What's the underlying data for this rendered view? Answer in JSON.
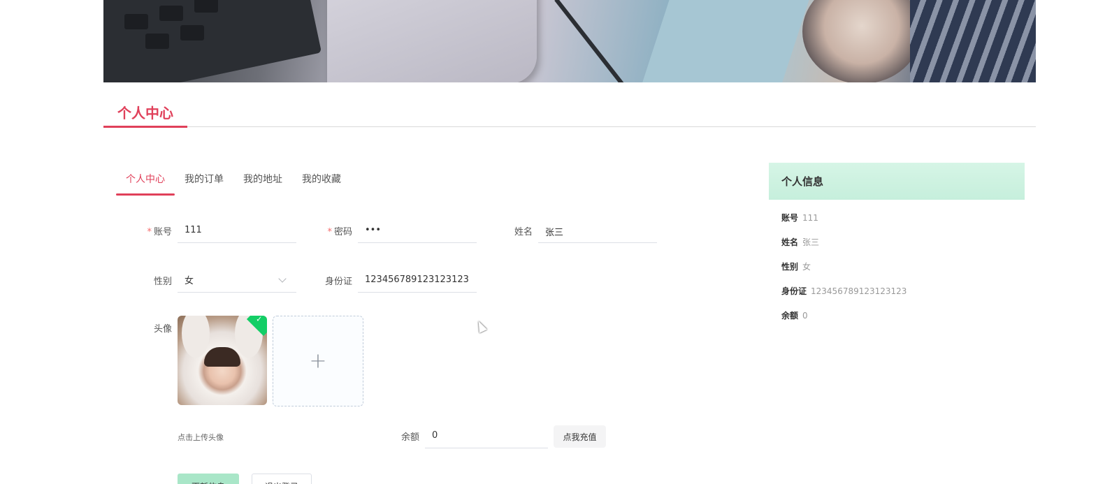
{
  "section": {
    "title": "个人中心"
  },
  "tabs": [
    {
      "label": "个人中心",
      "active": true
    },
    {
      "label": "我的订单",
      "active": false
    },
    {
      "label": "我的地址",
      "active": false
    },
    {
      "label": "我的收藏",
      "active": false
    }
  ],
  "form": {
    "account": {
      "label": "账号",
      "value": "111",
      "required": "*"
    },
    "password": {
      "label": "密码",
      "value": "•••",
      "required": "*"
    },
    "name": {
      "label": "姓名",
      "value": "张三"
    },
    "gender": {
      "label": "性别",
      "value": "女"
    },
    "idcard": {
      "label": "身份证",
      "value": "123456789123123123"
    },
    "avatar": {
      "label": "头像",
      "tip": "点击上传头像",
      "plus": "+"
    },
    "balance": {
      "label": "余额",
      "value": "0",
      "recharge": "点我充值"
    },
    "update_button": "更新信息",
    "logout_button": "退出登录"
  },
  "info": {
    "title": "个人信息",
    "rows": [
      {
        "key": "账号",
        "value": "111"
      },
      {
        "key": "姓名",
        "value": "张三"
      },
      {
        "key": "性别",
        "value": "女"
      },
      {
        "key": "身份证",
        "value": "123456789123123123"
      },
      {
        "key": "余额",
        "value": "0"
      }
    ]
  },
  "colors": {
    "accent": "#e0405a",
    "success": "#13ce66",
    "info_header": "#c6efdc"
  }
}
